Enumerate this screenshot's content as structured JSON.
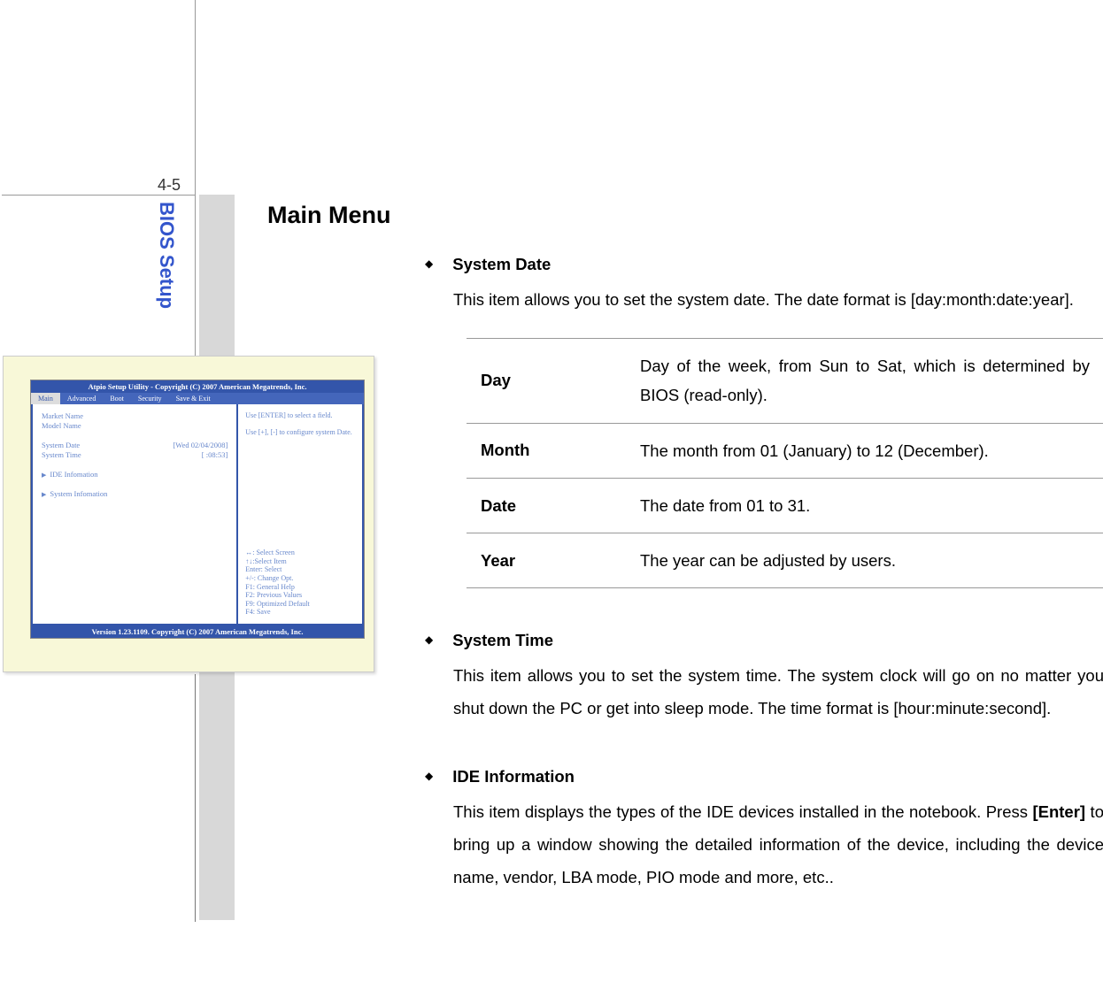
{
  "page_number": "4-5",
  "sidebar_label": "BIOS Setup",
  "main_title": "Main Menu",
  "sections": [
    {
      "title": "System Date",
      "desc_before": "This item allows you to set the system date.  The date format is [day:month:date:year].",
      "table": [
        {
          "term": "Day",
          "desc": "Day of the week, from Sun to Sat, which is determined by BIOS (read-only)."
        },
        {
          "term": "Month",
          "desc": "The month from 01 (January) to 12 (December)."
        },
        {
          "term": "Date",
          "desc": "The date from 01 to 31."
        },
        {
          "term": "Year",
          "desc": "The year can be adjusted by users."
        }
      ]
    },
    {
      "title": "System Time",
      "desc": "This item allows you to set the system time.  The system clock will go on no matter you shut down the PC or get into sleep mode.  The time format is [hour:minute:second]."
    },
    {
      "title": "IDE Information",
      "desc_parts": {
        "p1": "This item displays the types of the IDE devices installed in the notebook. Press ",
        "bold": "[Enter]",
        "p2": " to bring up a window showing the detailed information of the device, including the device name, vendor, LBA mode, PIO mode and more, etc.."
      }
    }
  ],
  "bios": {
    "header": "Atpio Setup Utility - Copyright (C) 2007 American Megatrends, Inc.",
    "tabs": [
      "Main",
      "Advanced",
      "Boot",
      "Security",
      "Save & Exit"
    ],
    "left": {
      "market": "Market Name",
      "model": "Model Name",
      "sysdate_label": "System Date",
      "sysdate_value": "[Wed 02/04/2008]",
      "systime_label": "System Time",
      "systime_value": "[    :08:53]",
      "ide": "IDE Infomation",
      "sysinfo": "System Infomation"
    },
    "right_top": {
      "l1": "Use [ENTER] to select a field.",
      "l2": "Use [+], [-] to configure system Date."
    },
    "right_bottom": {
      "l1": "↔: Select Screen",
      "l2": "↑↓:Select Item",
      "l3": "Enter: Select",
      "l4": "+/-: Change Opt.",
      "l5": "F1: General Help",
      "l6": "F2: Previous Values",
      "l7": "F9: Optimized Default",
      "l8": "F4: Save"
    },
    "footer": "Version 1.23.1109. Copyright (C) 2007 American Megatrends, Inc."
  }
}
